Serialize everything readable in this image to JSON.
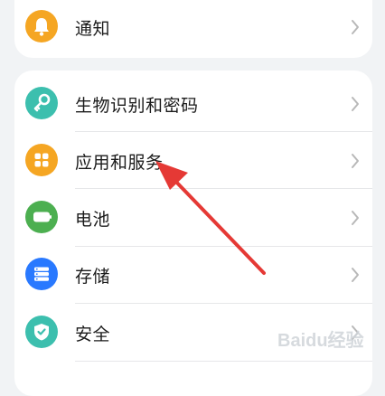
{
  "settings": {
    "top_group": [
      {
        "label": "通知",
        "icon": "bell-icon",
        "color": "#f5a623"
      }
    ],
    "main_group": [
      {
        "label": "生物识别和密码",
        "icon": "key-icon",
        "color": "#3cbfae"
      },
      {
        "label": "应用和服务",
        "icon": "apps-grid-icon",
        "color": "#f5a623"
      },
      {
        "label": "电池",
        "icon": "battery-icon",
        "color": "#4caf50"
      },
      {
        "label": "存储",
        "icon": "storage-icon",
        "color": "#2979ff"
      },
      {
        "label": "安全",
        "icon": "shield-check-icon",
        "color": "#3cbfae"
      }
    ]
  },
  "annotation": {
    "arrow_color": "#e53935"
  },
  "watermark": {
    "text": "Baidu经验"
  }
}
